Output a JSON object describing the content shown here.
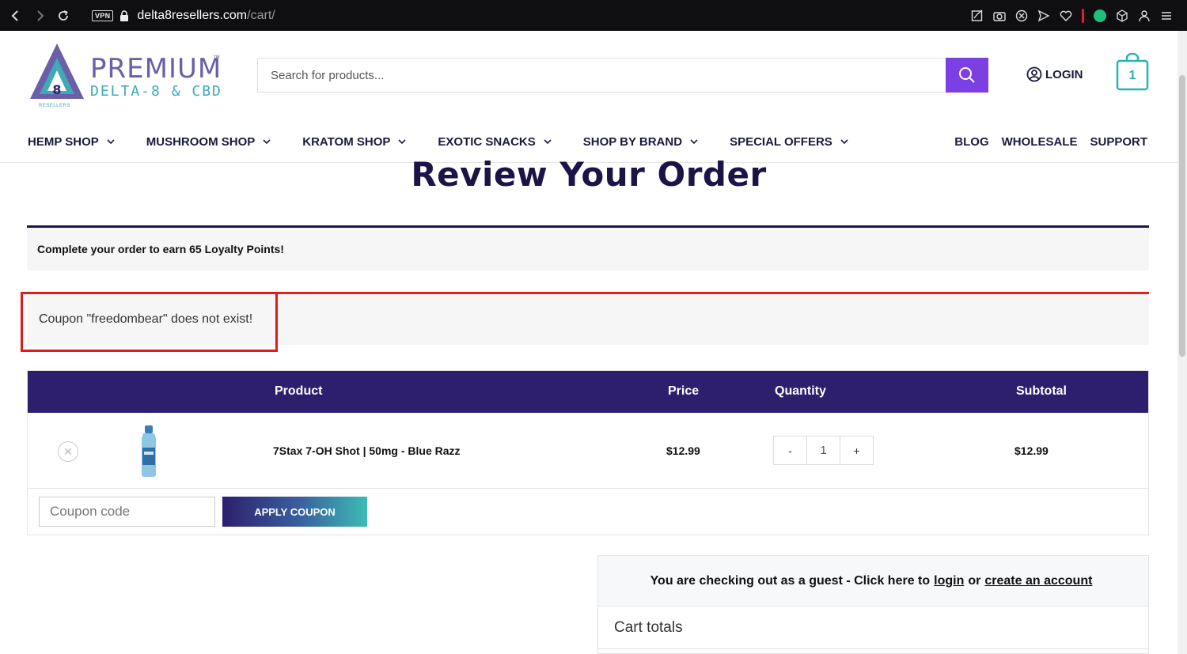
{
  "browser": {
    "vpn_label": "VPN",
    "url_domain": "delta8resellers.com",
    "url_path": "/cart/"
  },
  "header": {
    "logo_line1": "PREMIUM",
    "logo_tm": "™",
    "logo_line2": "DELTA-8 & CBD",
    "logo_sub": "RESELLERS",
    "search_placeholder": "Search for products...",
    "login_label": "LOGIN",
    "cart_count": "1"
  },
  "nav": {
    "items": [
      {
        "label": "HEMP SHOP"
      },
      {
        "label": "MUSHROOM SHOP"
      },
      {
        "label": "KRATOM SHOP"
      },
      {
        "label": "EXOTIC SNACKS"
      },
      {
        "label": "SHOP BY BRAND"
      },
      {
        "label": "SPECIAL OFFERS"
      }
    ],
    "right": [
      {
        "label": "BLOG"
      },
      {
        "label": "WHOLESALE"
      },
      {
        "label": "SUPPORT"
      }
    ]
  },
  "page": {
    "title": "Review Your Order",
    "loyalty_notice": "Complete your order to earn 65 Loyalty Points!",
    "error_notice": "Coupon \"freedombear\" does not exist!"
  },
  "cart": {
    "headers": {
      "product": "Product",
      "price": "Price",
      "quantity": "Quantity",
      "subtotal": "Subtotal"
    },
    "rows": [
      {
        "product": "7Stax 7-OH Shot | 50mg - Blue Razz",
        "price": "$12.99",
        "quantity": "1",
        "subtotal": "$12.99"
      }
    ],
    "qty_minus": "-",
    "qty_plus": "+",
    "coupon_placeholder": "Coupon code",
    "apply_label": "APPLY COUPON"
  },
  "checkout": {
    "guest_prefix": "You are checking out as a guest - Click here to",
    "login_link": "login",
    "or_text": "or",
    "create_link": "create an account",
    "totals_title": "Cart totals"
  },
  "colors": {
    "brand_dark": "#2e1f6e",
    "accent_purple": "#7b3fe4",
    "accent_teal": "#3cbcb4",
    "error_red": "#e01b1b"
  }
}
